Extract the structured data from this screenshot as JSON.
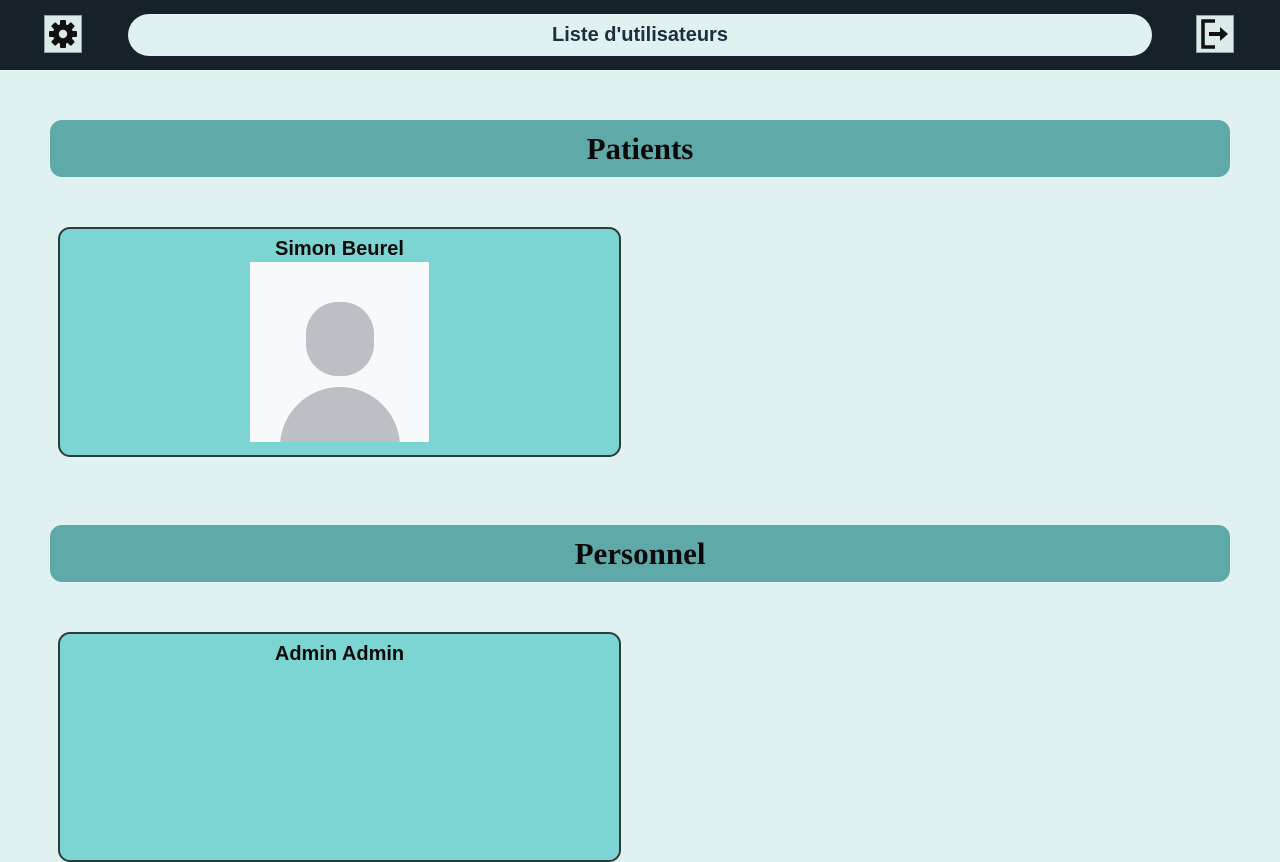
{
  "header": {
    "title": "Liste d'utilisateurs",
    "settings_icon": "gear-icon",
    "logout_icon": "logout-icon"
  },
  "sections": [
    {
      "title": "Patients",
      "users": [
        {
          "name": "Simon Beurel",
          "avatar": "default-avatar"
        }
      ]
    },
    {
      "title": "Personnel",
      "users": [
        {
          "name": "Admin Admin",
          "avatar": "default-avatar"
        }
      ]
    }
  ],
  "colors": {
    "topbar": "#16212a",
    "background": "#dff1f0",
    "section_header": "#5fa9a9",
    "card": "#7dd5d3"
  }
}
